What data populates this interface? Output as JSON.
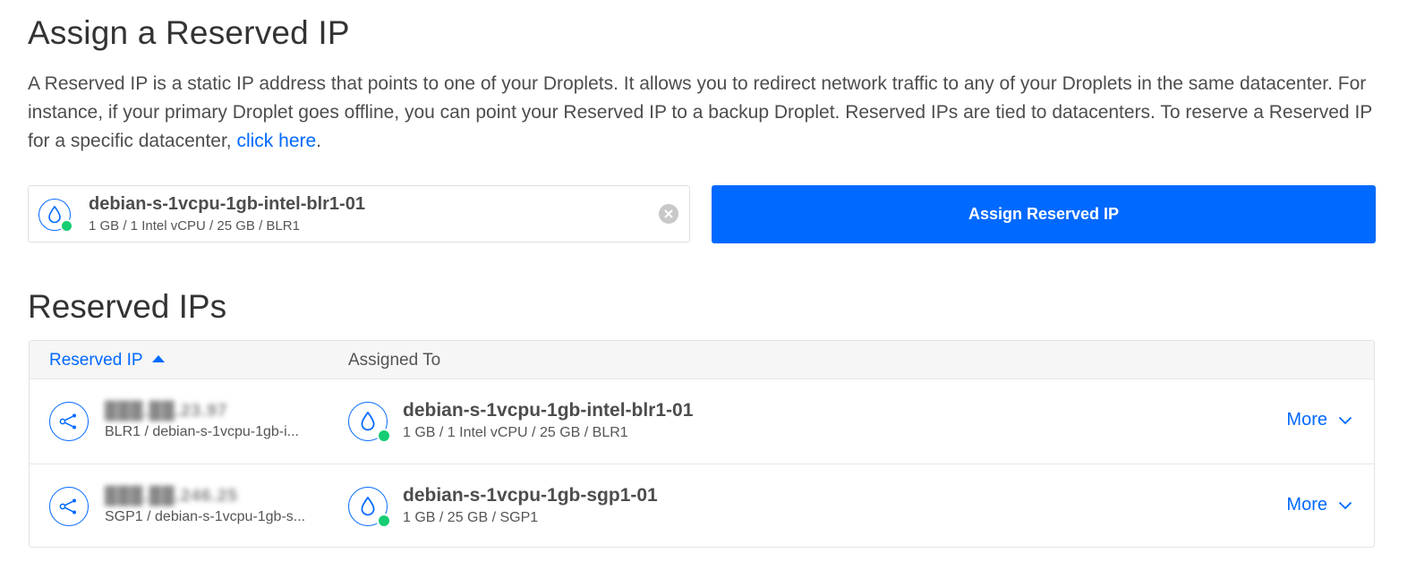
{
  "header": {
    "title": "Assign a Reserved IP",
    "description": "A Reserved IP is a static IP address that points to one of your Droplets. It allows you to redirect network traffic to any of your Droplets in the same datacenter. For instance, if your primary Droplet goes offline, you can point your Reserved IP to a backup Droplet. Reserved IPs are tied to datacenters. To reserve a Reserved IP for a specific datacenter, ",
    "link_text": "click here",
    "description_end": "."
  },
  "selected_droplet": {
    "name": "debian-s-1vcpu-1gb-intel-blr1-01",
    "meta": "1 GB / 1 Intel vCPU / 25 GB / BLR1",
    "status": "active",
    "icon": "droplet-icon"
  },
  "assign_button": {
    "label": "Assign Reserved IP"
  },
  "reserved_ips": {
    "title": "Reserved IPs",
    "columns": [
      "Reserved IP",
      "Assigned To"
    ],
    "sort": {
      "column": "Reserved IP",
      "direction": "ascending"
    },
    "rows": [
      {
        "ip": "███.██.23.97",
        "sub": "BLR1 / debian-s-1vcpu-1gb-i...",
        "droplet_name": "debian-s-1vcpu-1gb-intel-blr1-01",
        "droplet_meta": "1 GB / 1 Intel vCPU / 25 GB / BLR1",
        "more": "More"
      },
      {
        "ip": "███.██.246.25",
        "sub": "SGP1 / debian-s-1vcpu-1gb-s...",
        "droplet_name": "debian-s-1vcpu-1gb-sgp1-01",
        "droplet_meta": "1 GB / 25 GB / SGP1",
        "more": "More"
      }
    ]
  },
  "colors": {
    "accent": "#0069ff",
    "status_active": "#15cd72",
    "text": "#333333"
  }
}
